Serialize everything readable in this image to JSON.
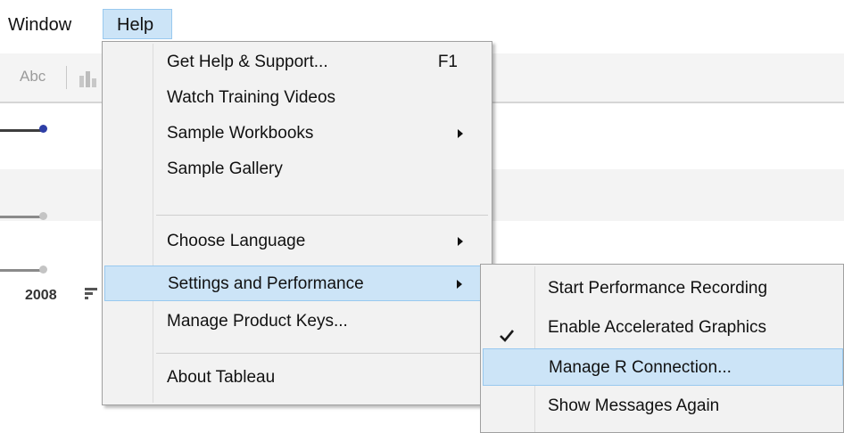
{
  "menubar": {
    "window_label": "Window",
    "help_label": "Help"
  },
  "toolbar": {
    "abc_label": "Abc"
  },
  "sheet": {
    "year_label": "2008"
  },
  "help_menu": {
    "items": [
      {
        "label": "Get Help & Support...",
        "shortcut": "F1"
      },
      {
        "label": "Watch Training Videos"
      },
      {
        "label": "Sample Workbooks",
        "submenu": true
      },
      {
        "label": "Sample Gallery"
      },
      {
        "label": "Choose Language",
        "submenu": true
      },
      {
        "label": "Settings and Performance",
        "submenu": true,
        "highlighted": true
      },
      {
        "label": "Manage Product Keys..."
      },
      {
        "label": "About Tableau"
      }
    ]
  },
  "settings_menu": {
    "items": [
      {
        "label": "Start Performance Recording"
      },
      {
        "label": "Enable Accelerated Graphics",
        "checked": true
      },
      {
        "label": "Manage R Connection...",
        "highlighted": true
      },
      {
        "label": "Show Messages Again"
      }
    ]
  },
  "icons": {
    "check": "check-icon",
    "submenu_arrow": "chevron-right-icon",
    "chart": "bar-chart-icon",
    "sort": "sort-icon"
  },
  "colors": {
    "highlight_bg": "#cce4f7",
    "highlight_border": "#99c9ef",
    "menu_bg": "#f2f2f2",
    "slider_active_dot": "#2e3fa6"
  }
}
